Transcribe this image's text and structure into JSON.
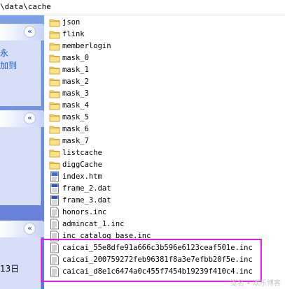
{
  "address": {
    "path": "\\data\\cache"
  },
  "taskpane": {
    "panels": [
      {
        "collapse_glyph": "«",
        "lines": [
          "永",
          "加到"
        ]
      },
      {
        "collapse_glyph": "«",
        "lines": []
      },
      {
        "collapse_glyph": "«",
        "lines": [
          "13日"
        ]
      }
    ]
  },
  "files": [
    {
      "name": "json",
      "icon": "folder-icon"
    },
    {
      "name": "flink",
      "icon": "folder-icon"
    },
    {
      "name": "memberlogin",
      "icon": "folder-icon"
    },
    {
      "name": "mask_0",
      "icon": "folder-icon"
    },
    {
      "name": "mask_1",
      "icon": "folder-icon"
    },
    {
      "name": "mask_2",
      "icon": "folder-icon"
    },
    {
      "name": "mask_3",
      "icon": "folder-icon"
    },
    {
      "name": "mask_4",
      "icon": "folder-icon"
    },
    {
      "name": "mask_5",
      "icon": "folder-icon"
    },
    {
      "name": "mask_6",
      "icon": "folder-icon"
    },
    {
      "name": "mask_7",
      "icon": "folder-icon"
    },
    {
      "name": "listcache",
      "icon": "folder-icon"
    },
    {
      "name": "diggCache",
      "icon": "folder-icon"
    },
    {
      "name": "index.htm",
      "icon": "html-file-icon"
    },
    {
      "name": "frame_2.dat",
      "icon": "dat-file-icon"
    },
    {
      "name": "frame_3.dat",
      "icon": "dat-file-icon"
    },
    {
      "name": "honors.inc",
      "icon": "text-file-icon"
    },
    {
      "name": "admincat_1.inc",
      "icon": "text-file-icon"
    },
    {
      "name": "inc_catalog_base.inc",
      "icon": "text-file-icon"
    },
    {
      "name": "caicai_55e8dfe91a666c3b596e6123ceaf501e.inc",
      "icon": "text-file-icon"
    },
    {
      "name": "caicai_200759272feb96381f8a3e7efbb20f5e.inc",
      "icon": "text-file-icon"
    },
    {
      "name": "caicai_d8e1c6474a0c455f7454b19239f410c4.inc",
      "icon": "text-file-icon"
    }
  ],
  "highlight": {
    "color": "#e01ee0"
  },
  "watermark": {
    "text": "签名 • 欢乐博客"
  }
}
